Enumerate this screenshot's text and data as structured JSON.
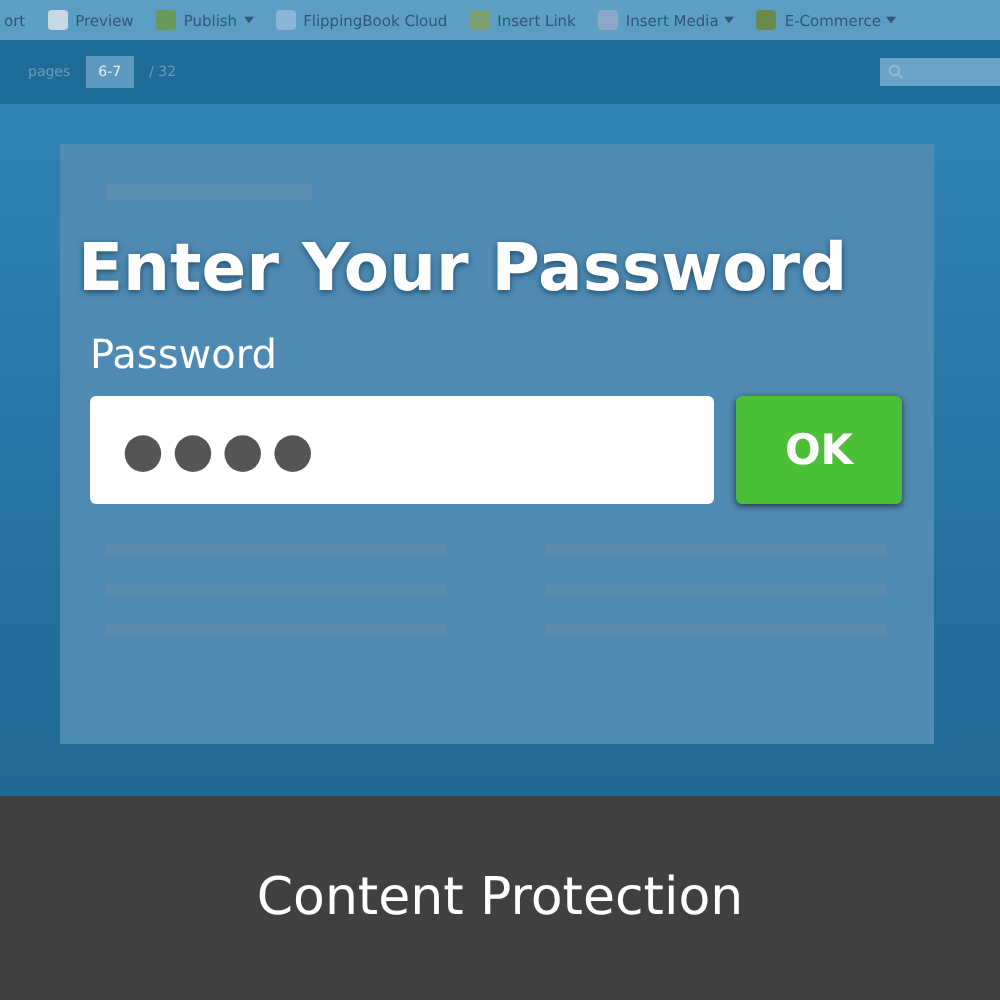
{
  "toolbar": {
    "items": [
      {
        "label": "ort",
        "dropdown": false
      },
      {
        "label": "Preview",
        "dropdown": false
      },
      {
        "label": "Publish",
        "dropdown": true
      },
      {
        "label": "FlippingBook Cloud",
        "dropdown": false
      },
      {
        "label": "Insert Link",
        "dropdown": false
      },
      {
        "label": "Insert Media",
        "dropdown": true
      },
      {
        "label": "E-Commerce",
        "dropdown": true
      }
    ]
  },
  "pages_bar": {
    "label": "pages",
    "current": "6-7",
    "total": "/ 32"
  },
  "dialog": {
    "title": "Enter Your Password",
    "field_label": "Password",
    "value": "●●●●",
    "button": "OK"
  },
  "caption": "Content Protection"
}
